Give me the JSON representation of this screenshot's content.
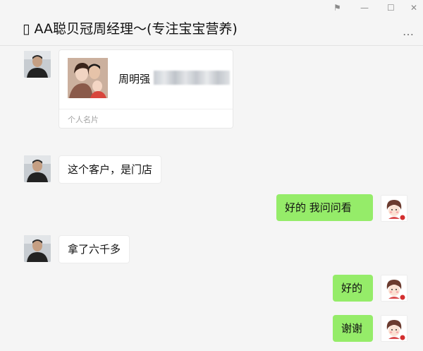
{
  "window": {
    "title": "▯ AA聪贝冠周经理～(专注宝宝营养)",
    "pin_glyph": "⚑",
    "minimize_glyph": "—",
    "maximize_glyph": "☐",
    "close_glyph": "✕",
    "more_glyph": "…"
  },
  "icons": {
    "pin": "pin-icon",
    "minimize": "minimize-icon",
    "maximize": "maximize-icon",
    "close": "close-icon",
    "more": "more-icon"
  },
  "messages": [
    {
      "sender": "other",
      "type": "card",
      "card": {
        "name": "周明强",
        "footer": "个人名片"
      }
    },
    {
      "sender": "other",
      "type": "text",
      "text": "这个客户，是门店"
    },
    {
      "sender": "self",
      "type": "text",
      "text": "好的   我问问看"
    },
    {
      "sender": "other",
      "type": "text",
      "text": "拿了六千多"
    },
    {
      "sender": "self",
      "type": "text",
      "text": "好的"
    },
    {
      "sender": "self",
      "type": "text",
      "text": "谢谢"
    }
  ],
  "colors": {
    "background": "#f5f5f5",
    "self_bubble": "#95ec69",
    "other_bubble": "#ffffff"
  }
}
